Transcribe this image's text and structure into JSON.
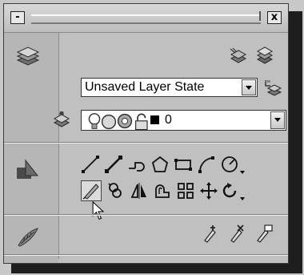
{
  "titlebar": {
    "minimize_glyph": "-",
    "close_glyph": "x"
  },
  "layers": {
    "layer_state": "Unsaved Layer State",
    "current_layer": "0",
    "layer_color": "#000000"
  },
  "icons": {
    "layers_panel": "layers-stack-icon",
    "draw_panel": "draw-shapes-icon",
    "modify_panel": "feather-brush-icon"
  }
}
